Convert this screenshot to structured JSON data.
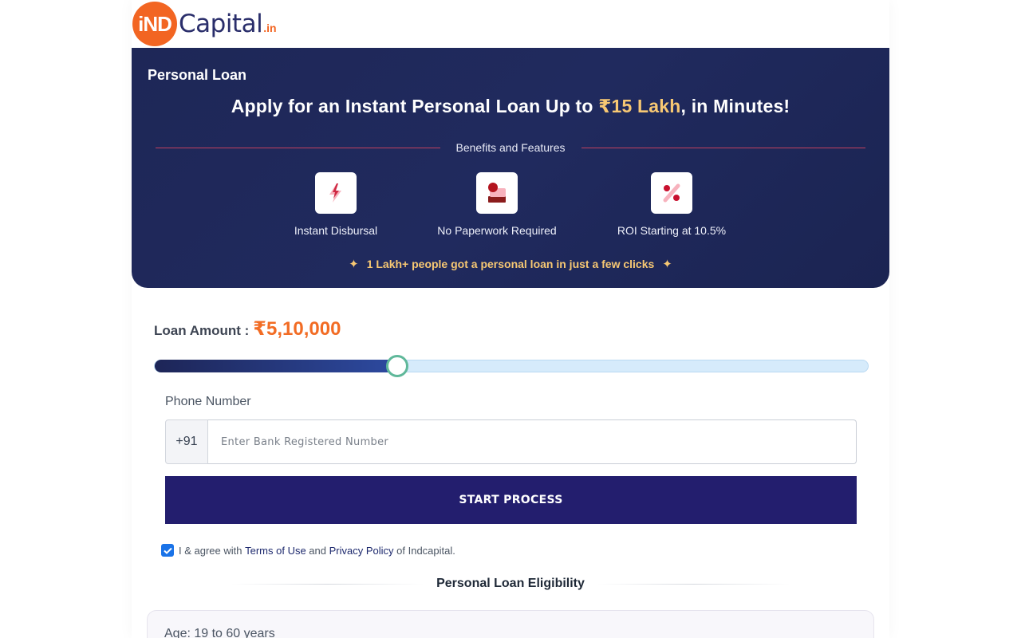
{
  "colors": {
    "brand_orange": "#f26522",
    "brand_navy": "#231e6e",
    "hero_bg": "#1e2757",
    "accent_gold": "#f7c873",
    "loan_value_orange": "#f26c24",
    "slider_thumb_border": "#5fb89a"
  },
  "header": {
    "logo_badge": "iND",
    "logo_word": "Capital",
    "logo_tld": ".in"
  },
  "hero": {
    "label": "Personal Loan",
    "title_prefix": "Apply for an Instant Personal Loan Up to ",
    "title_accent": "₹15 Lakh",
    "title_suffix": ", in Minutes!",
    "benefits_heading": "Benefits and Features",
    "features": [
      {
        "icon": "lightning-icon",
        "label": "Instant Disbursal"
      },
      {
        "icon": "document-stack-icon",
        "label": "No Paperwork Required"
      },
      {
        "icon": "percent-icon",
        "label": "ROI Starting at 10.5%"
      }
    ],
    "footer_note": "1 Lakh+ people got a personal loan in just a few clicks",
    "footer_icon": "sparkle-icon"
  },
  "loan": {
    "label": "Loan Amount :",
    "value": "₹5,10,000",
    "slider_fraction": 0.34
  },
  "phone": {
    "label": "Phone Number",
    "country_code": "+91",
    "placeholder": "Enter Bank Registered Number",
    "value": ""
  },
  "actions": {
    "start_label": "START PROCESS"
  },
  "agreement": {
    "checked": true,
    "prefix": "I & agree with ",
    "terms_label": "Terms of Use",
    "middle": " and ",
    "privacy_label": "Privacy Policy",
    "suffix": " of Indcapital."
  },
  "eligibility": {
    "heading": "Personal Loan Eligibility",
    "items": [
      "Age: 19 to 60 years"
    ]
  }
}
